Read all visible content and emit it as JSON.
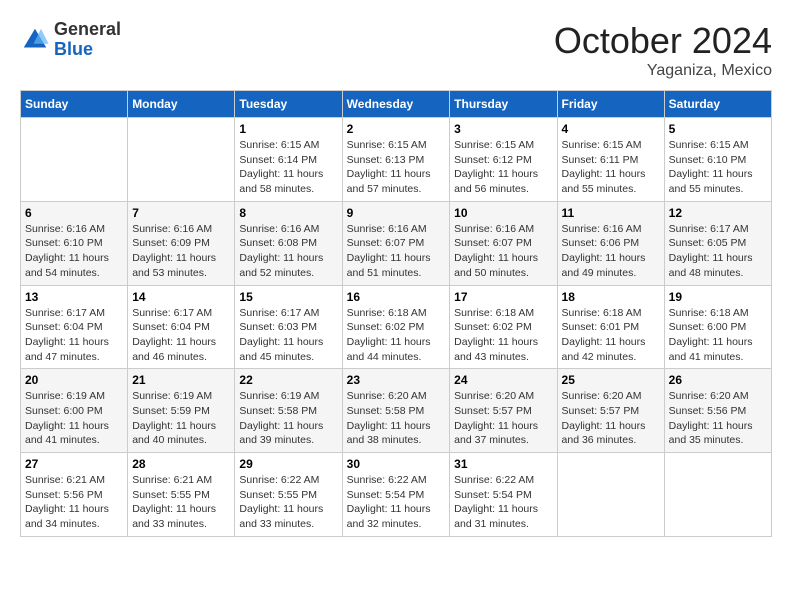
{
  "header": {
    "logo_general": "General",
    "logo_blue": "Blue",
    "month_title": "October 2024",
    "location": "Yaganiza, Mexico"
  },
  "days_of_week": [
    "Sunday",
    "Monday",
    "Tuesday",
    "Wednesday",
    "Thursday",
    "Friday",
    "Saturday"
  ],
  "weeks": [
    [
      null,
      null,
      {
        "day": 1,
        "sunrise": "6:15 AM",
        "sunset": "6:14 PM",
        "daylight": "11 hours and 58 minutes."
      },
      {
        "day": 2,
        "sunrise": "6:15 AM",
        "sunset": "6:13 PM",
        "daylight": "11 hours and 57 minutes."
      },
      {
        "day": 3,
        "sunrise": "6:15 AM",
        "sunset": "6:12 PM",
        "daylight": "11 hours and 56 minutes."
      },
      {
        "day": 4,
        "sunrise": "6:15 AM",
        "sunset": "6:11 PM",
        "daylight": "11 hours and 55 minutes."
      },
      {
        "day": 5,
        "sunrise": "6:15 AM",
        "sunset": "6:10 PM",
        "daylight": "11 hours and 55 minutes."
      }
    ],
    [
      {
        "day": 6,
        "sunrise": "6:16 AM",
        "sunset": "6:10 PM",
        "daylight": "11 hours and 54 minutes."
      },
      {
        "day": 7,
        "sunrise": "6:16 AM",
        "sunset": "6:09 PM",
        "daylight": "11 hours and 53 minutes."
      },
      {
        "day": 8,
        "sunrise": "6:16 AM",
        "sunset": "6:08 PM",
        "daylight": "11 hours and 52 minutes."
      },
      {
        "day": 9,
        "sunrise": "6:16 AM",
        "sunset": "6:07 PM",
        "daylight": "11 hours and 51 minutes."
      },
      {
        "day": 10,
        "sunrise": "6:16 AM",
        "sunset": "6:07 PM",
        "daylight": "11 hours and 50 minutes."
      },
      {
        "day": 11,
        "sunrise": "6:16 AM",
        "sunset": "6:06 PM",
        "daylight": "11 hours and 49 minutes."
      },
      {
        "day": 12,
        "sunrise": "6:17 AM",
        "sunset": "6:05 PM",
        "daylight": "11 hours and 48 minutes."
      }
    ],
    [
      {
        "day": 13,
        "sunrise": "6:17 AM",
        "sunset": "6:04 PM",
        "daylight": "11 hours and 47 minutes."
      },
      {
        "day": 14,
        "sunrise": "6:17 AM",
        "sunset": "6:04 PM",
        "daylight": "11 hours and 46 minutes."
      },
      {
        "day": 15,
        "sunrise": "6:17 AM",
        "sunset": "6:03 PM",
        "daylight": "11 hours and 45 minutes."
      },
      {
        "day": 16,
        "sunrise": "6:18 AM",
        "sunset": "6:02 PM",
        "daylight": "11 hours and 44 minutes."
      },
      {
        "day": 17,
        "sunrise": "6:18 AM",
        "sunset": "6:02 PM",
        "daylight": "11 hours and 43 minutes."
      },
      {
        "day": 18,
        "sunrise": "6:18 AM",
        "sunset": "6:01 PM",
        "daylight": "11 hours and 42 minutes."
      },
      {
        "day": 19,
        "sunrise": "6:18 AM",
        "sunset": "6:00 PM",
        "daylight": "11 hours and 41 minutes."
      }
    ],
    [
      {
        "day": 20,
        "sunrise": "6:19 AM",
        "sunset": "6:00 PM",
        "daylight": "11 hours and 41 minutes."
      },
      {
        "day": 21,
        "sunrise": "6:19 AM",
        "sunset": "5:59 PM",
        "daylight": "11 hours and 40 minutes."
      },
      {
        "day": 22,
        "sunrise": "6:19 AM",
        "sunset": "5:58 PM",
        "daylight": "11 hours and 39 minutes."
      },
      {
        "day": 23,
        "sunrise": "6:20 AM",
        "sunset": "5:58 PM",
        "daylight": "11 hours and 38 minutes."
      },
      {
        "day": 24,
        "sunrise": "6:20 AM",
        "sunset": "5:57 PM",
        "daylight": "11 hours and 37 minutes."
      },
      {
        "day": 25,
        "sunrise": "6:20 AM",
        "sunset": "5:57 PM",
        "daylight": "11 hours and 36 minutes."
      },
      {
        "day": 26,
        "sunrise": "6:20 AM",
        "sunset": "5:56 PM",
        "daylight": "11 hours and 35 minutes."
      }
    ],
    [
      {
        "day": 27,
        "sunrise": "6:21 AM",
        "sunset": "5:56 PM",
        "daylight": "11 hours and 34 minutes."
      },
      {
        "day": 28,
        "sunrise": "6:21 AM",
        "sunset": "5:55 PM",
        "daylight": "11 hours and 33 minutes."
      },
      {
        "day": 29,
        "sunrise": "6:22 AM",
        "sunset": "5:55 PM",
        "daylight": "11 hours and 33 minutes."
      },
      {
        "day": 30,
        "sunrise": "6:22 AM",
        "sunset": "5:54 PM",
        "daylight": "11 hours and 32 minutes."
      },
      {
        "day": 31,
        "sunrise": "6:22 AM",
        "sunset": "5:54 PM",
        "daylight": "11 hours and 31 minutes."
      },
      null,
      null
    ]
  ]
}
